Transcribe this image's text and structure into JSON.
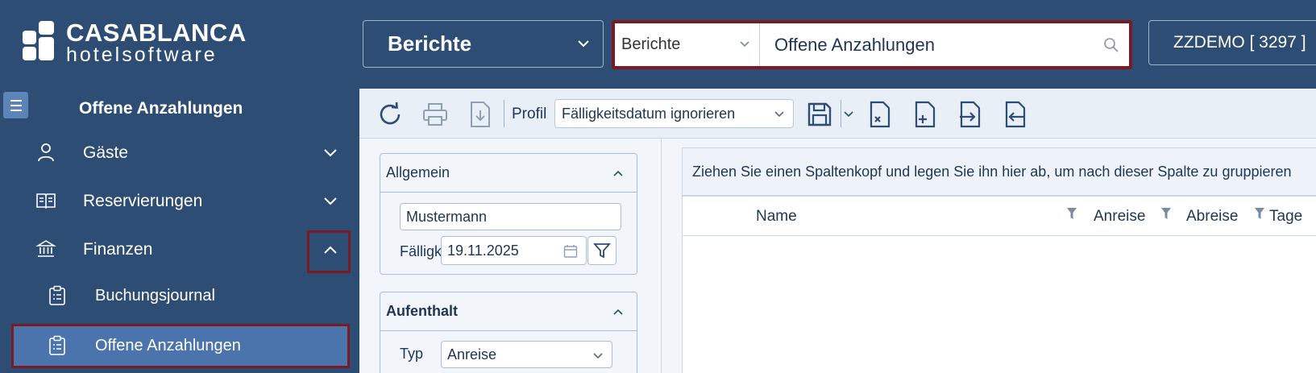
{
  "brand": {
    "line1": "CASABLANCA",
    "line2": "hotelsoftware"
  },
  "header": {
    "module_select": "Berichte",
    "search": {
      "category": "Berichte",
      "value": "Offene Anzahlungen"
    },
    "user": "ZZDEMO  [ 3297 ]"
  },
  "sidebar": {
    "title": "Offene Anzahlungen",
    "items": [
      {
        "label": "Gäste",
        "icon": "person-icon"
      },
      {
        "label": "Reservierungen",
        "icon": "book-icon"
      },
      {
        "label": "Finanzen",
        "icon": "bank-icon"
      }
    ],
    "subitems": [
      {
        "label": "Buchungsjournal",
        "icon": "clipboard-icon"
      },
      {
        "label": "Offene Anzahlungen",
        "icon": "clipboard-icon"
      }
    ]
  },
  "toolbar": {
    "profil_label": "Profil",
    "profil_value": "Fälligkeitsdatum ignorieren",
    "icons": [
      "refresh-icon",
      "print-icon",
      "download-icon",
      "save-icon",
      "file-remove-icon",
      "file-add-icon",
      "file-import-icon",
      "file-export-icon"
    ]
  },
  "filters": {
    "allgemein": {
      "title": "Allgemein",
      "name_value": "Mustermann",
      "faellig_label": "Fälligk",
      "date_value": "19.11.2025"
    },
    "aufenthalt": {
      "title": "Aufenthalt",
      "typ_label": "Typ",
      "typ_value": "Anreise"
    }
  },
  "grid": {
    "group_hint": "Ziehen Sie einen Spaltenkopf und legen Sie ihn hier ab, um nach dieser Spalte zu gruppieren",
    "columns": [
      "Name",
      "Anreise",
      "Abreise",
      "Tage"
    ]
  },
  "colors": {
    "header_bg": "#2d4d74",
    "active_item_bg": "#4a74ab",
    "highlight_border": "#7a1a22",
    "panel_bg": "#f2f5fa"
  }
}
